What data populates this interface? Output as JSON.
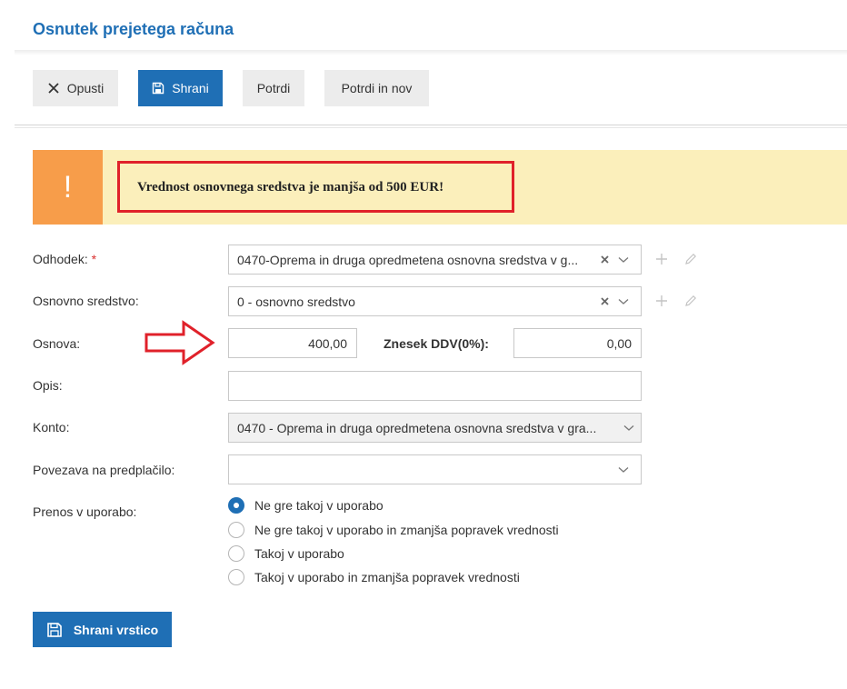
{
  "page": {
    "title": "Osnutek prejetega računa"
  },
  "toolbar": {
    "cancel_label": "Opusti",
    "save_label": "Shrani",
    "confirm_label": "Potrdi",
    "confirm_new_label": "Potrdi in nov"
  },
  "alert": {
    "icon": "!",
    "message": "Vrednost osnovnega sredstva je manjša od 500 EUR!"
  },
  "form": {
    "odhodek": {
      "label": "Odhodek:",
      "required_mark": "*",
      "value": "0470-Oprema in druga opredmetena osnovna sredstva v g..."
    },
    "osnovno_sredstvo": {
      "label": "Osnovno sredstvo:",
      "value": "0 - osnovno sredstvo"
    },
    "osnova": {
      "label": "Osnova:",
      "value": "400,00"
    },
    "znesek_ddv": {
      "label": "Znesek DDV(0%):",
      "value": "0,00"
    },
    "opis": {
      "label": "Opis:",
      "value": ""
    },
    "konto": {
      "label": "Konto:",
      "value": "0470 - Oprema in druga opredmetena osnovna sredstva v gra..."
    },
    "povezava": {
      "label": "Povezava na predplačilo:",
      "value": ""
    },
    "prenos": {
      "label": "Prenos v uporabo:",
      "options": [
        "Ne gre takoj v uporabo",
        "Ne gre takoj v uporabo in zmanjša popravek vrednosti",
        "Takoj v uporabo",
        "Takoj v uporabo in zmanjša popravek vrednosti"
      ],
      "selected_index": 0
    }
  },
  "footer": {
    "save_row_label": "Shrani vrstico"
  },
  "colors": {
    "primary": "#1f6fb5",
    "alert_background": "#fbefbb",
    "alert_icon": "#f79d4a",
    "highlight": "#e0212a"
  }
}
